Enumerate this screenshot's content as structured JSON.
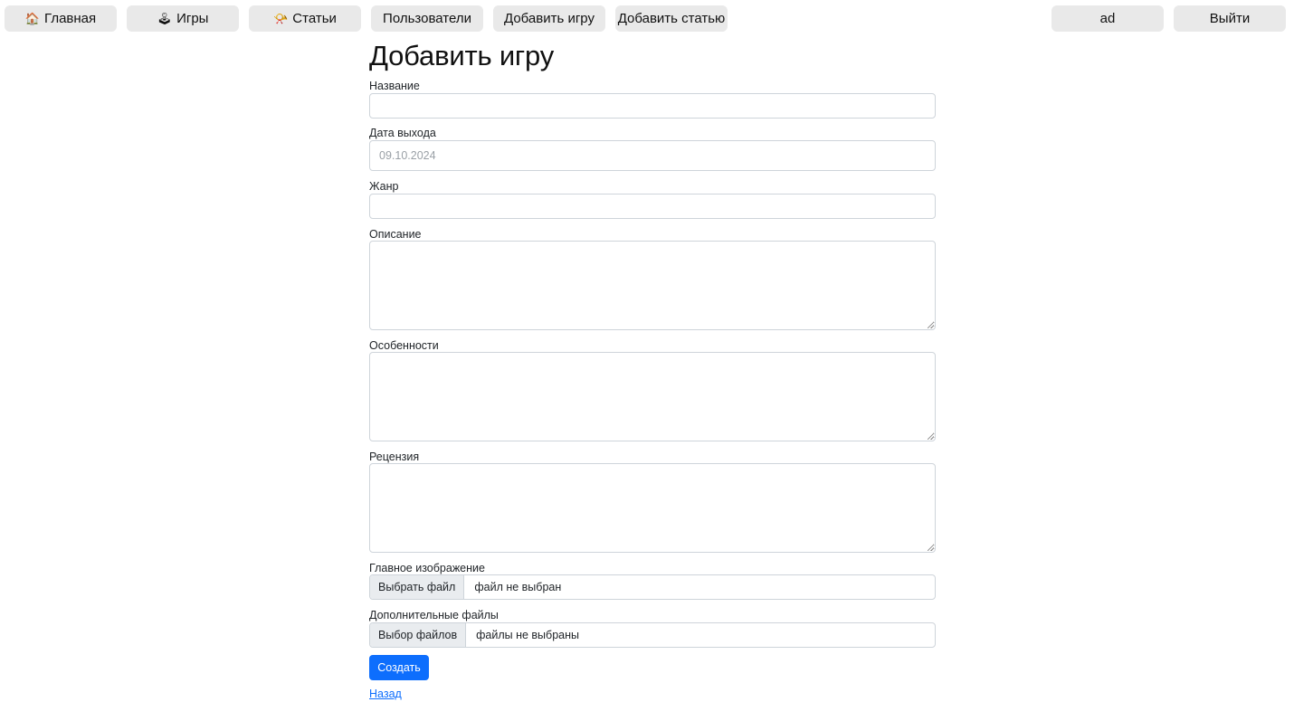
{
  "nav": {
    "home": {
      "icon": "🏠",
      "label": "Главная"
    },
    "games": {
      "icon": "🕹",
      "label": "Игры"
    },
    "articles": {
      "icon": "📯",
      "label": "Статьи"
    },
    "users": {
      "label": "Пользователи"
    },
    "add_game": {
      "label": "Добавить игру"
    },
    "add_article": {
      "label": "Добавить статью"
    },
    "user": {
      "label": "ad"
    },
    "logout": {
      "label": "Выйти"
    }
  },
  "page": {
    "title": "Добавить игру"
  },
  "form": {
    "name": {
      "label": "Название",
      "value": ""
    },
    "release_date": {
      "label": "Дата выхода",
      "value": "09.10.2024"
    },
    "genre": {
      "label": "Жанр",
      "value": ""
    },
    "description": {
      "label": "Описание",
      "value": ""
    },
    "features": {
      "label": "Особенности",
      "value": ""
    },
    "review": {
      "label": "Рецензия",
      "value": ""
    },
    "main_image": {
      "label": "Главное изображение",
      "button": "Выбрать файл",
      "status": "файл не выбран"
    },
    "extra_files": {
      "label": "Дополнительные файлы",
      "button": "Выбор файлов",
      "status": "файлы не выбраны"
    },
    "submit_label": "Создать",
    "back_label": "Назад"
  },
  "colors": {
    "primary": "#0d6efd",
    "nav_button_bg": "#e9e9e9",
    "border": "#ced4da"
  }
}
